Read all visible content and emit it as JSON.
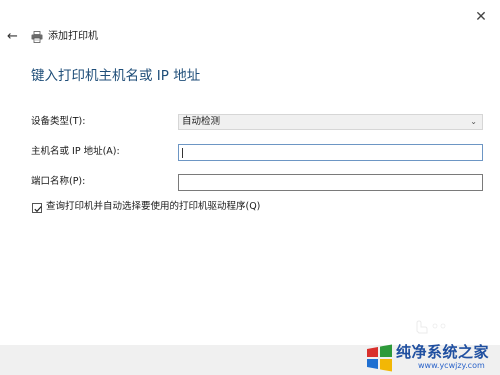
{
  "window": {
    "close_glyph": "✕",
    "back_glyph": "←",
    "title": "添加打印机",
    "title_icon": "printer-icon"
  },
  "main": {
    "heading": "键入打印机主机名或 IP 地址"
  },
  "form": {
    "device_type": {
      "label": "设备类型(T):",
      "value": "自动检测"
    },
    "hostname": {
      "label": "主机名或 IP 地址(A):",
      "value": ""
    },
    "port_name": {
      "label": "端口名称(P):",
      "value": ""
    },
    "query_printer": {
      "label": "查询打印机并自动选择要使用的打印机驱动程序(Q)",
      "checked": true
    }
  },
  "watermark": {
    "name": "纯净系统之家",
    "url": "www.ycwjzy.com",
    "colors": {
      "blue": "#1f4fa0",
      "green": "#2e9a3a",
      "red": "#d9302c",
      "yellow": "#f2b705"
    }
  },
  "colors": {
    "heading": "#1f4e79",
    "focus_border": "#6d96c4",
    "footer": "#f0f0f0"
  }
}
